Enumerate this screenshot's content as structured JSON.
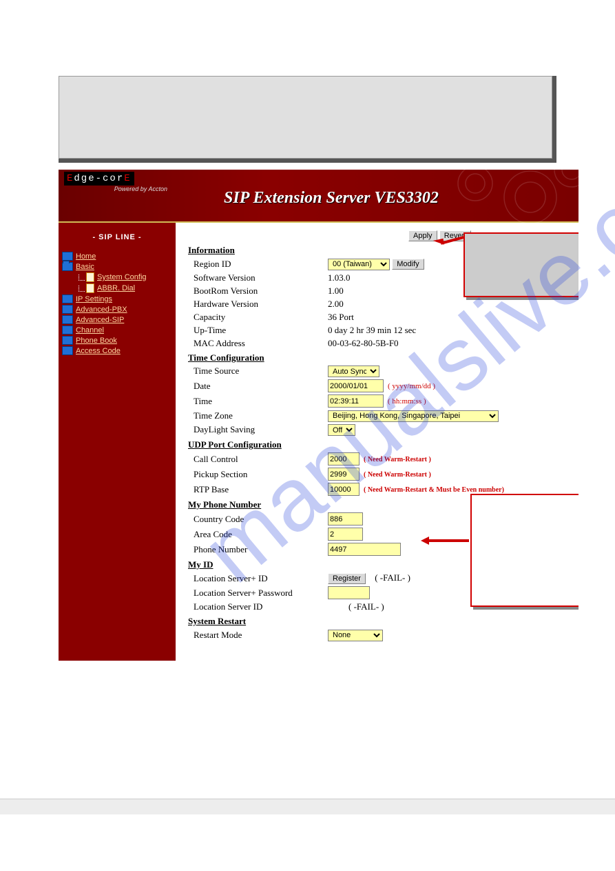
{
  "logo": {
    "text": "Edge-corE",
    "tagline": "Powered by Accton"
  },
  "header": {
    "title": "SIP Extension Server VES3302"
  },
  "sidebar": {
    "title": "- SIP LINE -",
    "items": [
      {
        "label": "Home"
      },
      {
        "label": "Basic",
        "children": [
          {
            "label": "System Config"
          },
          {
            "label": "ABBR. Dial"
          }
        ]
      },
      {
        "label": "IP Settings"
      },
      {
        "label": "Advanced-PBX"
      },
      {
        "label": "Advanced-SIP"
      },
      {
        "label": "Channel"
      },
      {
        "label": "Phone Book"
      },
      {
        "label": "Access Code"
      }
    ]
  },
  "buttons": {
    "apply": "Apply",
    "revert": "Revert",
    "modify": "Modify",
    "register": "Register"
  },
  "sections": {
    "information": {
      "title": "Information",
      "region_id_label": "Region ID",
      "region_id_value": "00 (Taiwan)",
      "software_version_label": "Software Version",
      "software_version_value": "1.03.0",
      "bootrom_label": "BootRom Version",
      "bootrom_value": "1.00",
      "hardware_label": "Hardware Version",
      "hardware_value": "2.00",
      "capacity_label": "Capacity",
      "capacity_value": "36 Port",
      "uptime_label": "Up-Time",
      "uptime_value": "0 day 2 hr 39 min 12 sec",
      "mac_label": "MAC Address",
      "mac_value": "00-03-62-80-5B-F0"
    },
    "time": {
      "title": "Time Configuration",
      "source_label": "Time Source",
      "source_value": "Auto Sync",
      "date_label": "Date",
      "date_value": "2000/01/01",
      "date_hint": "( yyyy/mm/dd )",
      "time_label": "Time",
      "time_value": "02:39:11",
      "time_hint": "( hh:mm:ss )",
      "tz_label": "Time Zone",
      "tz_value": "Beijing, Hong Kong, Singapore, Taipei",
      "dst_label": "DayLight Saving",
      "dst_value": "Off"
    },
    "udp": {
      "title": "UDP Port Configuration",
      "call_label": "Call Control",
      "call_value": "2000",
      "call_hint": "( Need Warm-Restart )",
      "pickup_label": "Pickup Section",
      "pickup_value": "2999",
      "pickup_hint": "( Need Warm-Restart )",
      "rtp_label": "RTP Base",
      "rtp_value": "10000",
      "rtp_hint": "( Need Warm-Restart & Must be Even number)"
    },
    "phone": {
      "title": "My Phone Number",
      "cc_label": "Country Code",
      "cc_value": "886",
      "area_label": "Area Code",
      "area_value": "2",
      "num_label": "Phone Number",
      "num_value": "4497"
    },
    "myid": {
      "title": "My ID",
      "ls_plus_id_label": "Location Server+ ID",
      "ls_plus_id_status": "( -FAIL- )",
      "ls_plus_pw_label": "Location Server+ Password",
      "ls_id_label": "Location Server ID",
      "ls_id_status": "( -FAIL- )"
    },
    "restart": {
      "title": "System Restart",
      "mode_label": "Restart Mode",
      "mode_value": "None"
    }
  }
}
